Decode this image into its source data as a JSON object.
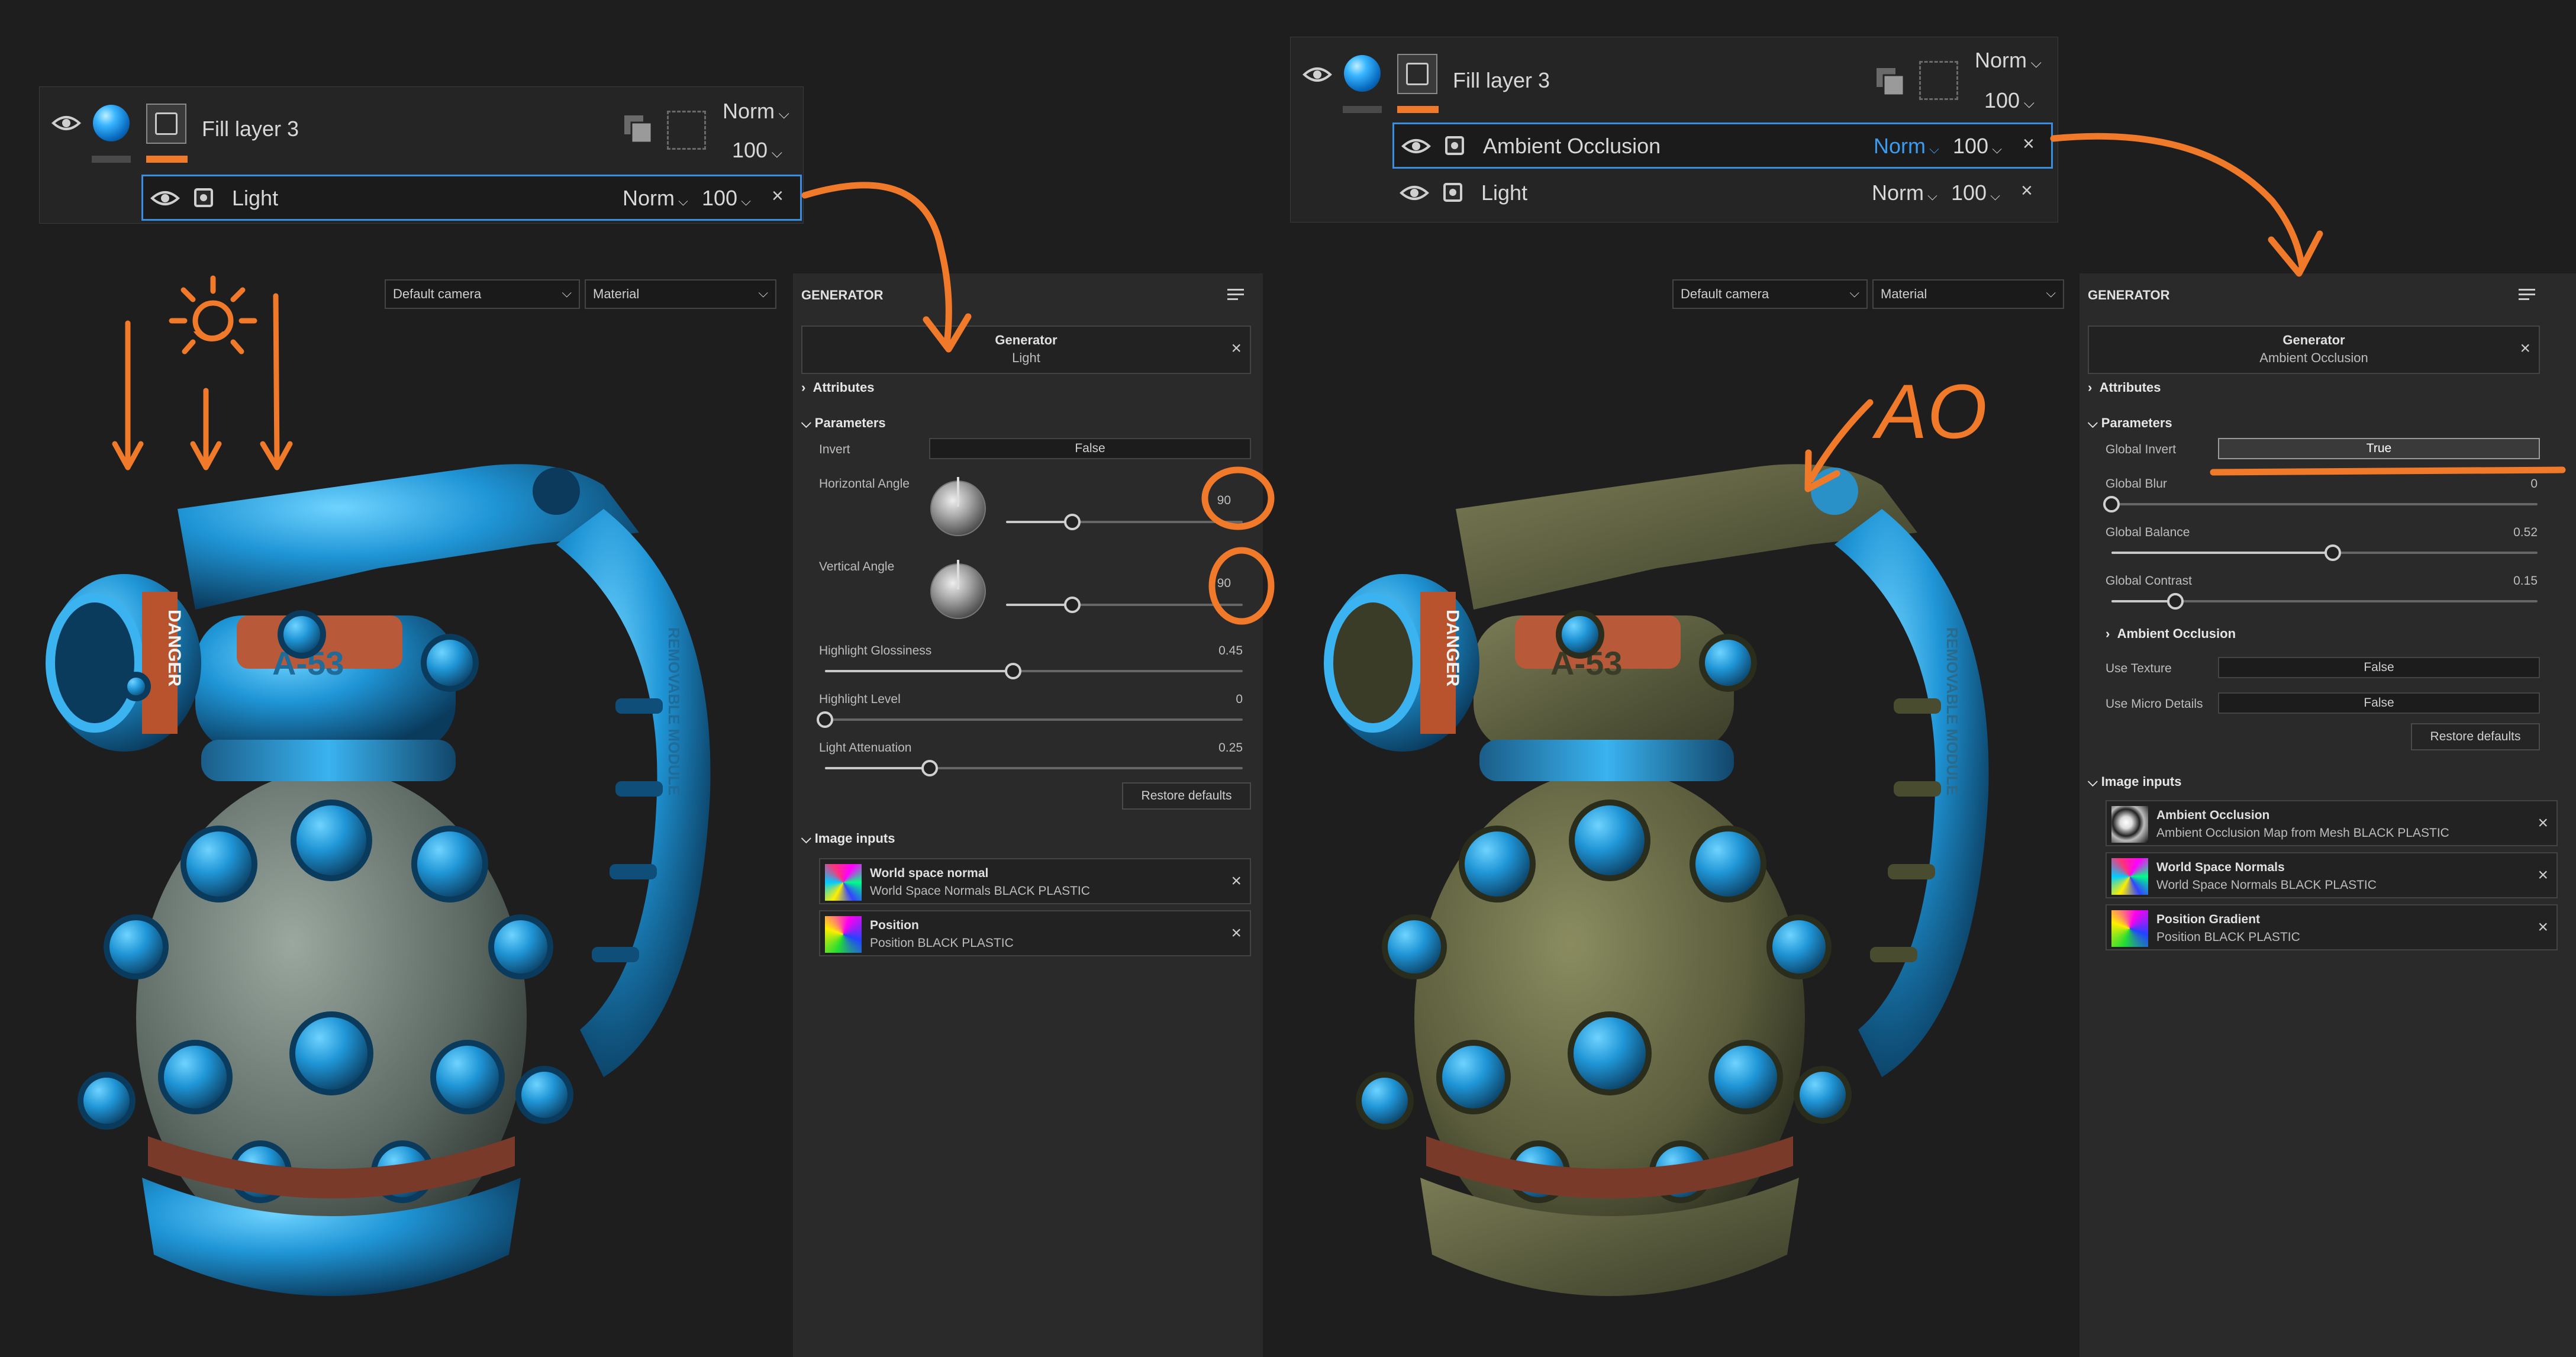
{
  "left": {
    "layers": {
      "fill_layer_name": "Fill layer 3",
      "blend_mode": "Norm",
      "opacity": "100",
      "sub_layers": [
        {
          "name": "Light",
          "blend": "Norm",
          "opacity": "100",
          "close": "×"
        }
      ]
    },
    "viewport": {
      "camera": "Default camera",
      "view": "Material",
      "label_text": "DANGER",
      "model_text": "A-53",
      "side_text": "REMOVABLE MODULE"
    },
    "generator": {
      "panel_title": "GENERATOR",
      "header_title": "Generator",
      "header_sub": "Light",
      "attributes": "Attributes",
      "parameters": "Parameters",
      "invert_label": "Invert",
      "invert_value": "False",
      "h_angle_label": "Horizontal Angle",
      "h_angle_value": "90",
      "v_angle_label": "Vertical Angle",
      "v_angle_value": "90",
      "sliders": [
        {
          "label": "Highlight Glossiness",
          "value": "0.45",
          "fraction": 0.45
        },
        {
          "label": "Highlight Level",
          "value": "0",
          "fraction": 0.0
        },
        {
          "label": "Light Attenuation",
          "value": "0.25",
          "fraction": 0.25
        }
      ],
      "restore": "Restore defaults",
      "image_inputs": "Image inputs",
      "inputs": [
        {
          "title": "World space normal",
          "sub": "World Space Normals BLACK PLASTIC"
        },
        {
          "title": "Position",
          "sub": "Position BLACK PLASTIC"
        }
      ]
    }
  },
  "right": {
    "layers": {
      "fill_layer_name": "Fill layer 3",
      "blend_mode": "Norm",
      "opacity": "100",
      "sub_layers": [
        {
          "name": "Ambient Occlusion",
          "blend": "Norm",
          "opacity": "100",
          "close": "×"
        },
        {
          "name": "Light",
          "blend": "Norm",
          "opacity": "100",
          "close": "×"
        }
      ]
    },
    "viewport": {
      "camera": "Default camera",
      "view": "Material",
      "annotation": "AO",
      "label_text": "DANGER",
      "model_text": "A-53",
      "side_text": "REMOVABLE MODULE"
    },
    "generator": {
      "panel_title": "GENERATOR",
      "header_title": "Generator",
      "header_sub": "Ambient Occlusion",
      "attributes": "Attributes",
      "parameters": "Parameters",
      "global_invert_label": "Global Invert",
      "global_invert_value": "True",
      "sliders": [
        {
          "label": "Global Blur",
          "value": "0",
          "fraction": 0.0
        },
        {
          "label": "Global Balance",
          "value": "0.52",
          "fraction": 0.52
        },
        {
          "label": "Global Contrast",
          "value": "0.15",
          "fraction": 0.15
        }
      ],
      "ao_section": "Ambient Occlusion",
      "use_texture_label": "Use Texture",
      "use_texture_value": "False",
      "use_micro_label": "Use Micro Details",
      "use_micro_value": "False",
      "restore": "Restore defaults",
      "image_inputs": "Image inputs",
      "inputs": [
        {
          "title": "Ambient Occlusion",
          "sub": "Ambient Occlusion Map from Mesh BLACK PLASTIC"
        },
        {
          "title": "World Space Normals",
          "sub": "World Space Normals BLACK PLASTIC"
        },
        {
          "title": "Position Gradient",
          "sub": "Position BLACK PLASTIC"
        }
      ]
    }
  },
  "icons": {
    "eye": "eye-icon",
    "close": "close-icon",
    "chevron": "chevron-down-icon",
    "menu": "panel-menu-icon",
    "copy": "copy-icon",
    "sun": "sun-icon",
    "arrow": "arrow-annotation"
  },
  "colors": {
    "accent": "#f07a2a",
    "selection": "#3a8ee0",
    "mesh_blue": "#2aa0e0"
  }
}
